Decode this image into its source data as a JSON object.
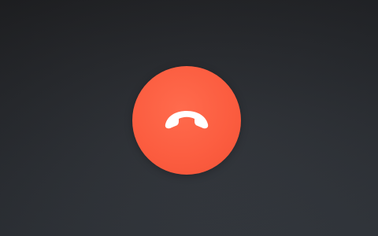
{
  "call": {
    "end_button": {
      "icon": "phone-hangup-icon",
      "color": "#fb5c3f",
      "icon_color": "#ffffff"
    }
  },
  "background": {
    "top_color": "#232427",
    "bottom_color": "#3a3f46"
  }
}
